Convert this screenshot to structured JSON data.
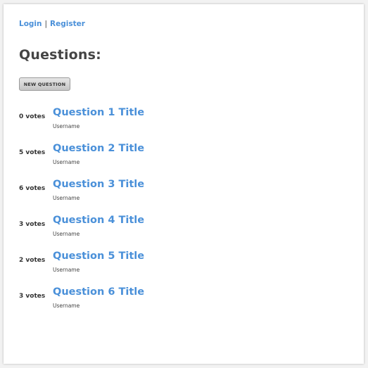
{
  "nav": {
    "login_label": "Login",
    "separator": "|",
    "register_label": "Register"
  },
  "page_title": "Questions:",
  "new_question_label": "NEW QUESTION",
  "questions": [
    {
      "votes": "0 votes",
      "title": "Question 1 Title",
      "username": "Username"
    },
    {
      "votes": "5 votes",
      "title": "Question 2 Title",
      "username": "Username"
    },
    {
      "votes": "6 votes",
      "title": "Question 3 Title",
      "username": "Username"
    },
    {
      "votes": "3 votes",
      "title": "Question 4 Title",
      "username": "Username"
    },
    {
      "votes": "2 votes",
      "title": "Question 5 Title",
      "username": "Username"
    },
    {
      "votes": "3 votes",
      "title": "Question 6 Title",
      "username": "Username"
    }
  ],
  "colors": {
    "link": "#4a90d9",
    "heading": "#444444",
    "background": "#f2f2f2",
    "card": "#ffffff"
  }
}
